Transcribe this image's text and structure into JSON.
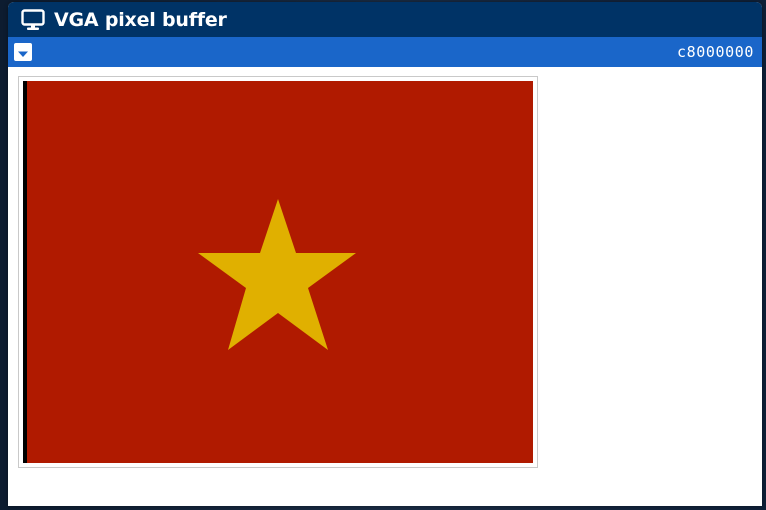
{
  "window": {
    "title": "VGA pixel buffer",
    "title_icon": "monitor-icon",
    "dropdown_icon": "caret-down-icon",
    "address": "c8000000"
  },
  "colors": {
    "titlebar": "#003366",
    "toolbar": "#1a66c9",
    "flag_red": "#b01a00",
    "star_gold": "#e0b000",
    "canvas_edge": "#000000"
  },
  "display": {
    "content": "flag with five-pointed star"
  }
}
